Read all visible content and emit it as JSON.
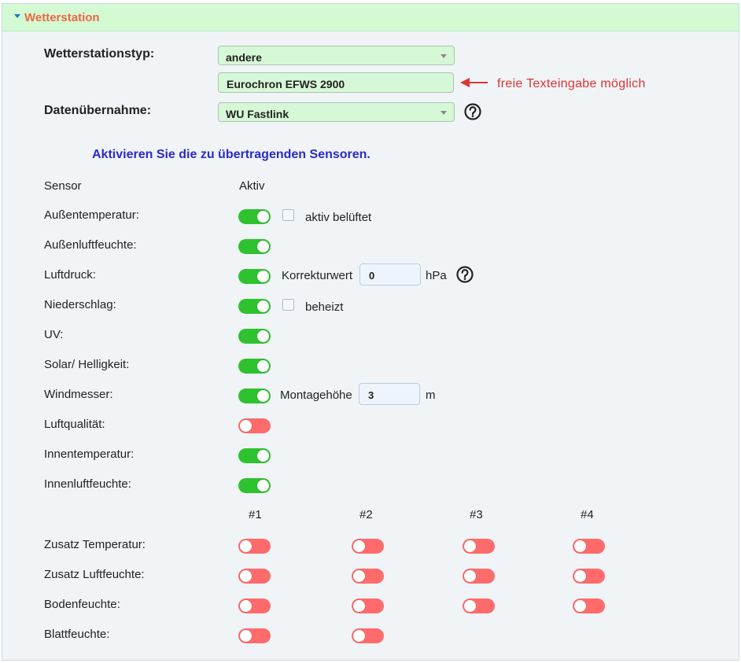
{
  "panel": {
    "title": "Wetterstation"
  },
  "config": {
    "station_type_label": "Wetterstationstyp:",
    "station_type_value": "andere",
    "station_name_value": "Eurochron EFWS 2900",
    "free_text_hint": "freie Texteingabe möglich",
    "data_transfer_label": "Datenübernahme:",
    "data_transfer_value": "WU Fastlink"
  },
  "sensors": {
    "heading": "Aktivieren Sie die zu übertragenden Sensoren.",
    "col_sensor": "Sensor",
    "col_active": "Aktiv",
    "rows": [
      {
        "label": "Außentemperatur:",
        "active": true,
        "extra_check_label": "aktiv belüftet",
        "extra_checked": false
      },
      {
        "label": "Außenluftfeuchte:",
        "active": true
      },
      {
        "label": "Luftdruck:",
        "active": true,
        "extra_input_label": "Korrekturwert",
        "extra_input_value": "0",
        "extra_unit": "hPa"
      },
      {
        "label": "Niederschlag:",
        "active": true,
        "extra_check_label": "beheizt",
        "extra_checked": false
      },
      {
        "label": "UV:",
        "active": true
      },
      {
        "label": "Solar/ Helligkeit:",
        "active": true
      },
      {
        "label": "Windmesser:",
        "active": true,
        "extra_input_label": "Montagehöhe",
        "extra_input_value": "3",
        "extra_unit": "m"
      },
      {
        "label": "Luftqualität:",
        "active": false
      },
      {
        "label": "Innentemperatur:",
        "active": true
      },
      {
        "label": "Innenluftfeuchte:",
        "active": true
      }
    ]
  },
  "extra_sensors": {
    "columns": [
      "#1",
      "#2",
      "#3",
      "#4"
    ],
    "rows": [
      {
        "label": "Zusatz Temperatur:",
        "states": [
          false,
          false,
          false,
          false
        ]
      },
      {
        "label": "Zusatz Luftfeuchte:",
        "states": [
          false,
          false,
          false,
          false
        ]
      },
      {
        "label": "Bodenfeuchte:",
        "states": [
          false,
          false,
          false,
          false
        ]
      },
      {
        "label": "Blattfeuchte:",
        "states": [
          false,
          false
        ]
      }
    ]
  },
  "colors": {
    "toggle_on": "#2fc22f",
    "toggle_off": "#ff6b6b",
    "header_bg": "#d4fad4",
    "title": "#ee6644",
    "heading": "#2a2acc",
    "hint": "#dd3333"
  },
  "icons": {
    "collapse": "triangle-down-icon",
    "help": "question-circle-icon",
    "hint_arrow": "arrow-left-icon"
  }
}
